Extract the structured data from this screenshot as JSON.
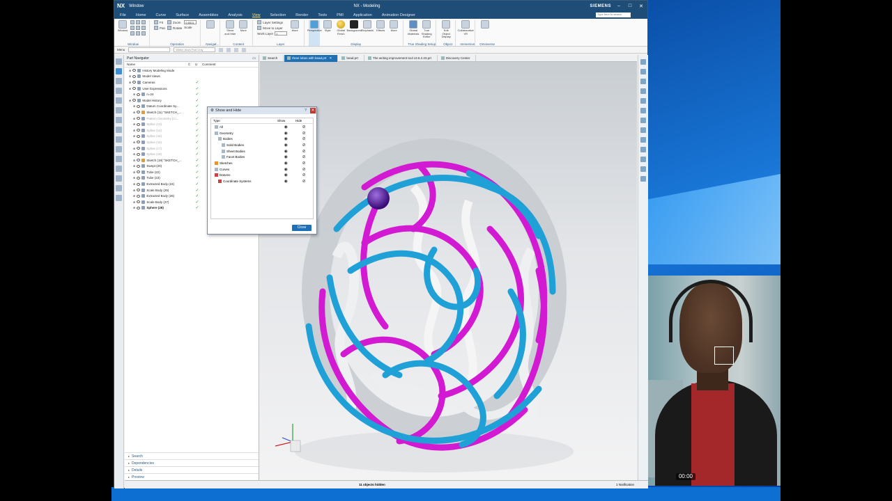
{
  "window": {
    "logo": "NX",
    "window_menu": "Window",
    "title": "NX - Modeling",
    "brand": "SIEMENS",
    "search_placeholder": "Type here to search"
  },
  "menu_tabs": [
    "File",
    "Home",
    "Curve",
    "Surface",
    "Assemblies",
    "Analysis",
    "View",
    "Selection",
    "Render",
    "Tools",
    "PMI",
    "Application",
    "Animation Designer"
  ],
  "active_menu": "View",
  "ribbon": {
    "window_label": "Window",
    "fit_label": "Fit",
    "pan_label": "Pan",
    "zoom_label": "Zoom",
    "rotate_label": "Rotate",
    "zoom_value": "0.6511",
    "scale_label": "Scale",
    "show_hide_label": "Show and Hide",
    "more_label": "More",
    "layer_settings": "Layer Settings",
    "move_to_layer": "Move to Layer",
    "work_layer": "Work Layer",
    "work_layer_value": "1",
    "perspective": "Perspective",
    "style": "Style",
    "global_finish": "Global Finish",
    "background": "Background",
    "emphasis": "Emphasis",
    "effects": "Effects",
    "global_materials": "Global Materials",
    "true_shading_editor": "True Shading Editor",
    "edit_object_display": "Edit Object Display",
    "collaborative_vr": "Collaborative VR",
    "groups": [
      "Window",
      "Operation",
      "Navigat...",
      "Content",
      "Layer",
      "Display",
      "True Shading Setup",
      "Object",
      "Immersive",
      "Omniverse"
    ]
  },
  "quickbar": {
    "menu_label": "Menu",
    "filter_placeholder": "Within Work Part Only"
  },
  "part_navigator": {
    "title": "Part Navigator",
    "col_name": "Name",
    "col_c": "C",
    "col_u": "U",
    "col_comment": "Comment",
    "rows": [
      {
        "label": "History Modeling Mode",
        "indent": 1,
        "check": false,
        "style": ""
      },
      {
        "label": "Model Views",
        "indent": 1,
        "check": false,
        "style": ""
      },
      {
        "label": "Cameras",
        "indent": 1,
        "check": true,
        "style": ""
      },
      {
        "label": "User Expressions",
        "indent": 1,
        "check": true,
        "style": ""
      },
      {
        "label": "n=24",
        "indent": 2,
        "check": true,
        "style": ""
      },
      {
        "label": "Model History",
        "indent": 1,
        "check": true,
        "style": ""
      },
      {
        "label": "Datum Coordinate Sy...",
        "indent": 2,
        "check": true,
        "style": ""
      },
      {
        "label": "Sketch (11) \"SKETCH_...",
        "indent": 2,
        "check": true,
        "style": "sk"
      },
      {
        "label": "Pattern Geometry [Ci...",
        "indent": 2,
        "check": true,
        "style": "dim"
      },
      {
        "label": "Spline (13)",
        "indent": 2,
        "check": true,
        "style": "dim"
      },
      {
        "label": "Spline (14)",
        "indent": 2,
        "check": true,
        "style": "dim"
      },
      {
        "label": "Spline (15)",
        "indent": 2,
        "check": true,
        "style": "dim"
      },
      {
        "label": "Spline (16)",
        "indent": 2,
        "check": true,
        "style": "dim"
      },
      {
        "label": "Spline (17)",
        "indent": 2,
        "check": true,
        "style": "dim"
      },
      {
        "label": "Spline (18)",
        "indent": 2,
        "check": true,
        "style": "dim"
      },
      {
        "label": "Sketch (19) \"SKETCH_...",
        "indent": 2,
        "check": true,
        "style": "sk"
      },
      {
        "label": "Swept (20)",
        "indent": 2,
        "check": true,
        "style": ""
      },
      {
        "label": "Tube (22)",
        "indent": 2,
        "check": true,
        "style": ""
      },
      {
        "label": "Tube (23)",
        "indent": 2,
        "check": true,
        "style": ""
      },
      {
        "label": "Extracted Body (24)",
        "indent": 2,
        "check": true,
        "style": ""
      },
      {
        "label": "Scale Body (25)",
        "indent": 2,
        "check": true,
        "style": ""
      },
      {
        "label": "Extracted Body (26)",
        "indent": 2,
        "check": true,
        "style": ""
      },
      {
        "label": "Scale Body (27)",
        "indent": 2,
        "check": true,
        "style": ""
      },
      {
        "label": "Sphere (28)",
        "indent": 2,
        "check": true,
        "style": "bold"
      }
    ],
    "bottom_sections": [
      "Search",
      "Dependencies",
      "Details",
      "Preview"
    ]
  },
  "tabs": [
    {
      "label": "Search",
      "active": false
    },
    {
      "label": "three lobes with bead.prt",
      "active": true
    },
    {
      "label": "bead.prt",
      "active": false
    },
    {
      "label": "The writing improvement tool v3.5.2.23.prt",
      "active": false
    },
    {
      "label": "Discovery Center",
      "active": false
    }
  ],
  "dialog": {
    "title": "Show and Hide",
    "help": "?",
    "close_x": "✕",
    "col_type": "Type",
    "col_show": "Show",
    "col_hide": "Hide",
    "rows": [
      {
        "label": "All",
        "indent": 1,
        "kind": ""
      },
      {
        "label": "Geometry",
        "indent": 1,
        "kind": ""
      },
      {
        "label": "Bodies",
        "indent": 2,
        "kind": ""
      },
      {
        "label": "Solid Bodies",
        "indent": 3,
        "kind": ""
      },
      {
        "label": "Sheet Bodies",
        "indent": 3,
        "kind": ""
      },
      {
        "label": "Facet Bodies",
        "indent": 3,
        "kind": ""
      },
      {
        "label": "Sketches",
        "indent": 1,
        "kind": "sk"
      },
      {
        "label": "Curves",
        "indent": 1,
        "kind": ""
      },
      {
        "label": "Datums",
        "indent": 1,
        "kind": "cs"
      },
      {
        "label": "Coordinate Systems",
        "indent": 2,
        "kind": "cs"
      }
    ],
    "close_label": "Close"
  },
  "status": {
    "message": "11 objects hidden",
    "notification": "1 Notification"
  },
  "webcam": {
    "timer": "00:00"
  },
  "colors": {
    "magenta_tube": "#d21ad2",
    "cyan_tube": "#1fa0d6",
    "white_sheet": "#f2f2f2",
    "sphere": "#6a2aa8",
    "nx_title": "#1e4e78"
  }
}
